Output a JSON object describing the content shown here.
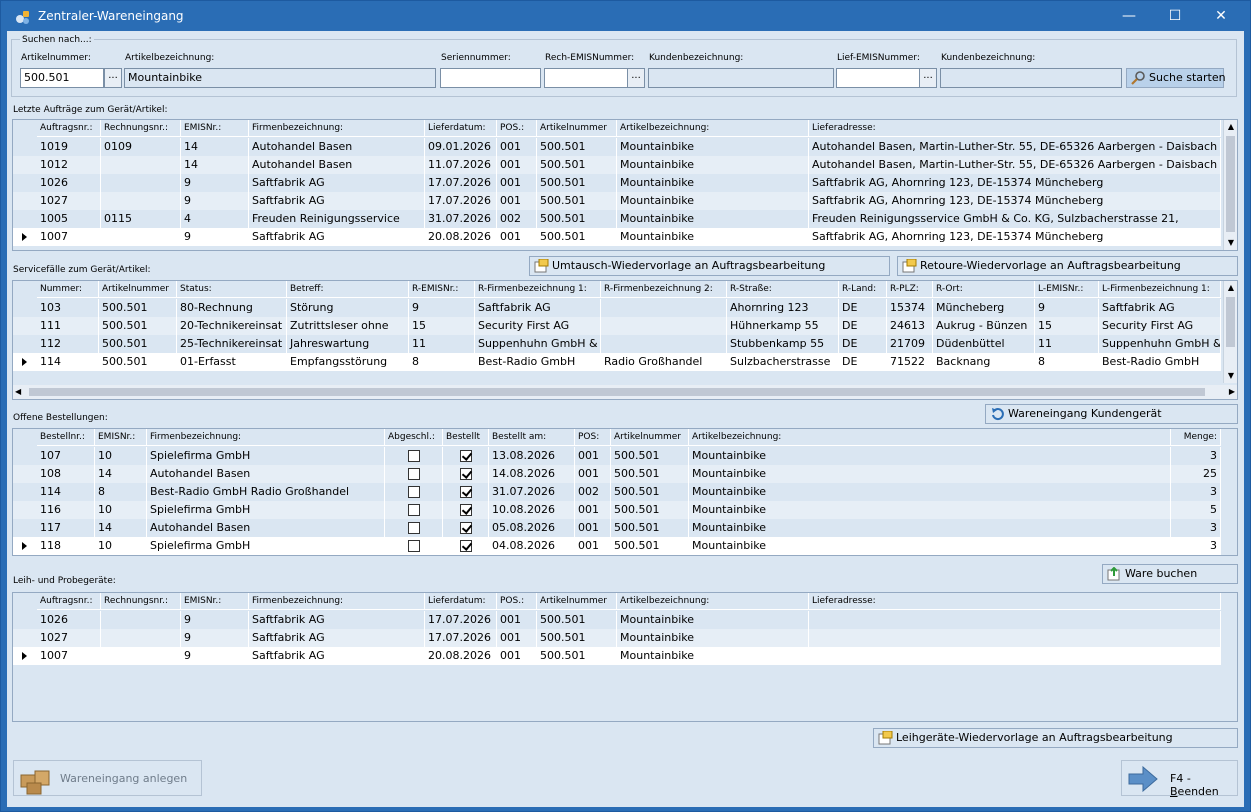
{
  "window": {
    "title": "Zentraler-Wareneingang",
    "minimize": "—",
    "maximize": "☐",
    "close": "✕"
  },
  "search": {
    "section_label": "Suchen nach...:",
    "artikelnummer_label": "Artikelnummer:",
    "artikelnummer_value": "500.501",
    "artikelbezeichnung_label": "Artikelbezeichnung:",
    "artikelbezeichnung_value": "Mountainbike",
    "seriennummer_label": "Seriennummer:",
    "seriennummer_value": "",
    "rech_emis_label": "Rech-EMISNummer:",
    "rech_emis_value": "",
    "kundenbez1_label": "Kundenbezeichnung:",
    "kundenbez1_value": "",
    "lief_emis_label": "Lief-EMISNummer:",
    "lief_emis_value": "",
    "kundenbez2_label": "Kundenbezeichnung:",
    "kundenbez2_value": "",
    "dots": "...",
    "search_button": "Suche starten"
  },
  "orders": {
    "section_label": "Letzte Aufträge zum Gerät/Artikel:",
    "headers": [
      "Auftragsnr.:",
      "Rechnungsnr.:",
      "EMISNr.:",
      "Firmenbezeichnung:",
      "Lieferdatum:",
      "POS.:",
      "Artikelnummer",
      "Artikelbezeichnung:",
      "Lieferadresse:"
    ],
    "rows": [
      [
        "1019",
        "0109",
        "14",
        "Autohandel Basen",
        "09.01.2026",
        "001",
        "500.501",
        "Mountainbike",
        "Autohandel Basen, Martin-Luther-Str. 55, DE-65326 Aarbergen - Daisbach"
      ],
      [
        "1012",
        "",
        "14",
        "Autohandel Basen",
        "11.07.2026",
        "001",
        "500.501",
        "Mountainbike",
        "Autohandel Basen, Martin-Luther-Str. 55, DE-65326 Aarbergen - Daisbach"
      ],
      [
        "1026",
        "",
        "9",
        "Saftfabrik AG",
        "17.07.2026",
        "001",
        "500.501",
        "Mountainbike",
        "Saftfabrik AG, Ahornring 123, DE-15374 Müncheberg"
      ],
      [
        "1027",
        "",
        "9",
        "Saftfabrik AG",
        "17.07.2026",
        "001",
        "500.501",
        "Mountainbike",
        "Saftfabrik AG, Ahornring 123, DE-15374 Müncheberg"
      ],
      [
        "1005",
        "0115",
        "4",
        "Freuden Reinigungsservice",
        "31.07.2026",
        "002",
        "500.501",
        "Mountainbike",
        "Freuden Reinigungsservice GmbH & Co. KG, Sulzbacherstrasse 21,"
      ],
      [
        "1007",
        "",
        "9",
        "Saftfabrik AG",
        "20.08.2026",
        "001",
        "500.501",
        "Mountainbike",
        "Saftfabrik AG, Ahornring 123, DE-15374 Müncheberg"
      ]
    ]
  },
  "service": {
    "section_label": "Servicefälle zum Gerät/Artikel:",
    "btn_umtausch": "Umtausch-Wiedervorlage an Auftragsbearbeitung",
    "btn_retoure": "Retoure-Wiedervorlage an Auftragsbearbeitung",
    "headers": [
      "Nummer:",
      "Artikelnummer",
      "Status:",
      "Betreff:",
      "R-EMISNr.:",
      "R-Firmenbezeichnung 1:",
      "R-Firmenbezeichnung 2:",
      "R-Straße:",
      "R-Land:",
      "R-PLZ:",
      "R-Ort:",
      "L-EMISNr.:",
      "L-Firmenbezeichnung 1:"
    ],
    "rows": [
      [
        "103",
        "500.501",
        "80-Rechnung",
        "Störung",
        "9",
        "Saftfabrik AG",
        "",
        "Ahornring 123",
        "DE",
        "15374",
        "Müncheberg",
        "9",
        "Saftfabrik AG"
      ],
      [
        "111",
        "500.501",
        "20-Technikereinsat",
        "Zutrittsleser ohne",
        "15",
        "Security First AG",
        "",
        "Hühnerkamp 55",
        "DE",
        "24613",
        "Aukrug - Bünzen",
        "15",
        "Security First AG"
      ],
      [
        "112",
        "500.501",
        "25-Technikereinsat",
        "Jahreswartung",
        "11",
        "Suppenhuhn GmbH &",
        "",
        "Stubbenkamp 55",
        "DE",
        "21709",
        "Düdenbüttel",
        "11",
        "Suppenhuhn GmbH &"
      ],
      [
        "114",
        "500.501",
        "01-Erfasst",
        "Empfangsstörung",
        "8",
        "Best-Radio GmbH",
        "Radio Großhandel",
        "Sulzbacherstrasse",
        "DE",
        "71522",
        "Backnang",
        "8",
        "Best-Radio GmbH"
      ]
    ]
  },
  "bestellungen": {
    "section_label": "Offene Bestellungen:",
    "btn_wareneingang": "Wareneingang Kundengerät",
    "headers": [
      "Bestellnr.:",
      "EMISNr.:",
      "Firmenbezeichnung:",
      "Abgeschl.:",
      "Bestellt",
      "Bestellt am:",
      "POS:",
      "Artikelnummer",
      "Artikelbezeichnung:",
      "Menge:"
    ],
    "rows": [
      {
        "nr": "107",
        "emis": "10",
        "firma": "Spielefirma GmbH",
        "abgeschl": false,
        "bestellt": true,
        "am": "13.08.2026",
        "pos": "001",
        "art": "500.501",
        "bez": "Mountainbike",
        "menge": "3"
      },
      {
        "nr": "108",
        "emis": "14",
        "firma": "Autohandel Basen",
        "abgeschl": false,
        "bestellt": true,
        "am": "14.08.2026",
        "pos": "001",
        "art": "500.501",
        "bez": "Mountainbike",
        "menge": "25"
      },
      {
        "nr": "114",
        "emis": "8",
        "firma": "Best-Radio GmbH Radio Großhandel",
        "abgeschl": false,
        "bestellt": true,
        "am": "31.07.2026",
        "pos": "002",
        "art": "500.501",
        "bez": "Mountainbike",
        "menge": "3"
      },
      {
        "nr": "116",
        "emis": "10",
        "firma": "Spielefirma GmbH",
        "abgeschl": false,
        "bestellt": true,
        "am": "10.08.2026",
        "pos": "001",
        "art": "500.501",
        "bez": "Mountainbike",
        "menge": "5"
      },
      {
        "nr": "117",
        "emis": "14",
        "firma": "Autohandel Basen",
        "abgeschl": false,
        "bestellt": true,
        "am": "05.08.2026",
        "pos": "001",
        "art": "500.501",
        "bez": "Mountainbike",
        "menge": "3"
      },
      {
        "nr": "118",
        "emis": "10",
        "firma": "Spielefirma GmbH",
        "abgeschl": false,
        "bestellt": true,
        "am": "04.08.2026",
        "pos": "001",
        "art": "500.501",
        "bez": "Mountainbike",
        "menge": "3"
      }
    ]
  },
  "leih": {
    "section_label": "Leih- und Probegeräte:",
    "btn_ware_buchen": "Ware buchen",
    "btn_leih_wv": "Leihgeräte-Wiedervorlage an Auftragsbearbeitung",
    "headers": [
      "Auftragsnr.:",
      "Rechnungsnr.:",
      "EMISNr.:",
      "Firmenbezeichnung:",
      "Lieferdatum:",
      "POS.:",
      "Artikelnummer",
      "Artikelbezeichnung:",
      "Lieferadresse:"
    ],
    "rows": [
      [
        "1026",
        "",
        "9",
        "Saftfabrik AG",
        "17.07.2026",
        "001",
        "500.501",
        "Mountainbike",
        ""
      ],
      [
        "1027",
        "",
        "9",
        "Saftfabrik AG",
        "17.07.2026",
        "001",
        "500.501",
        "Mountainbike",
        ""
      ],
      [
        "1007",
        "",
        "9",
        "Saftfabrik AG",
        "20.08.2026",
        "001",
        "500.501",
        "Mountainbike",
        ""
      ]
    ]
  },
  "footer": {
    "btn_wareneingang_anlegen": "Wareneingang anlegen",
    "btn_beenden_prefix": "F4 - ",
    "btn_beenden_key": "B",
    "btn_beenden_rest": "eenden"
  },
  "colors": {
    "titlebar": "#2a6db5",
    "client": "#dae6f2",
    "row_alt": "#e6eef6",
    "accent_button": "#b9d1ea"
  }
}
